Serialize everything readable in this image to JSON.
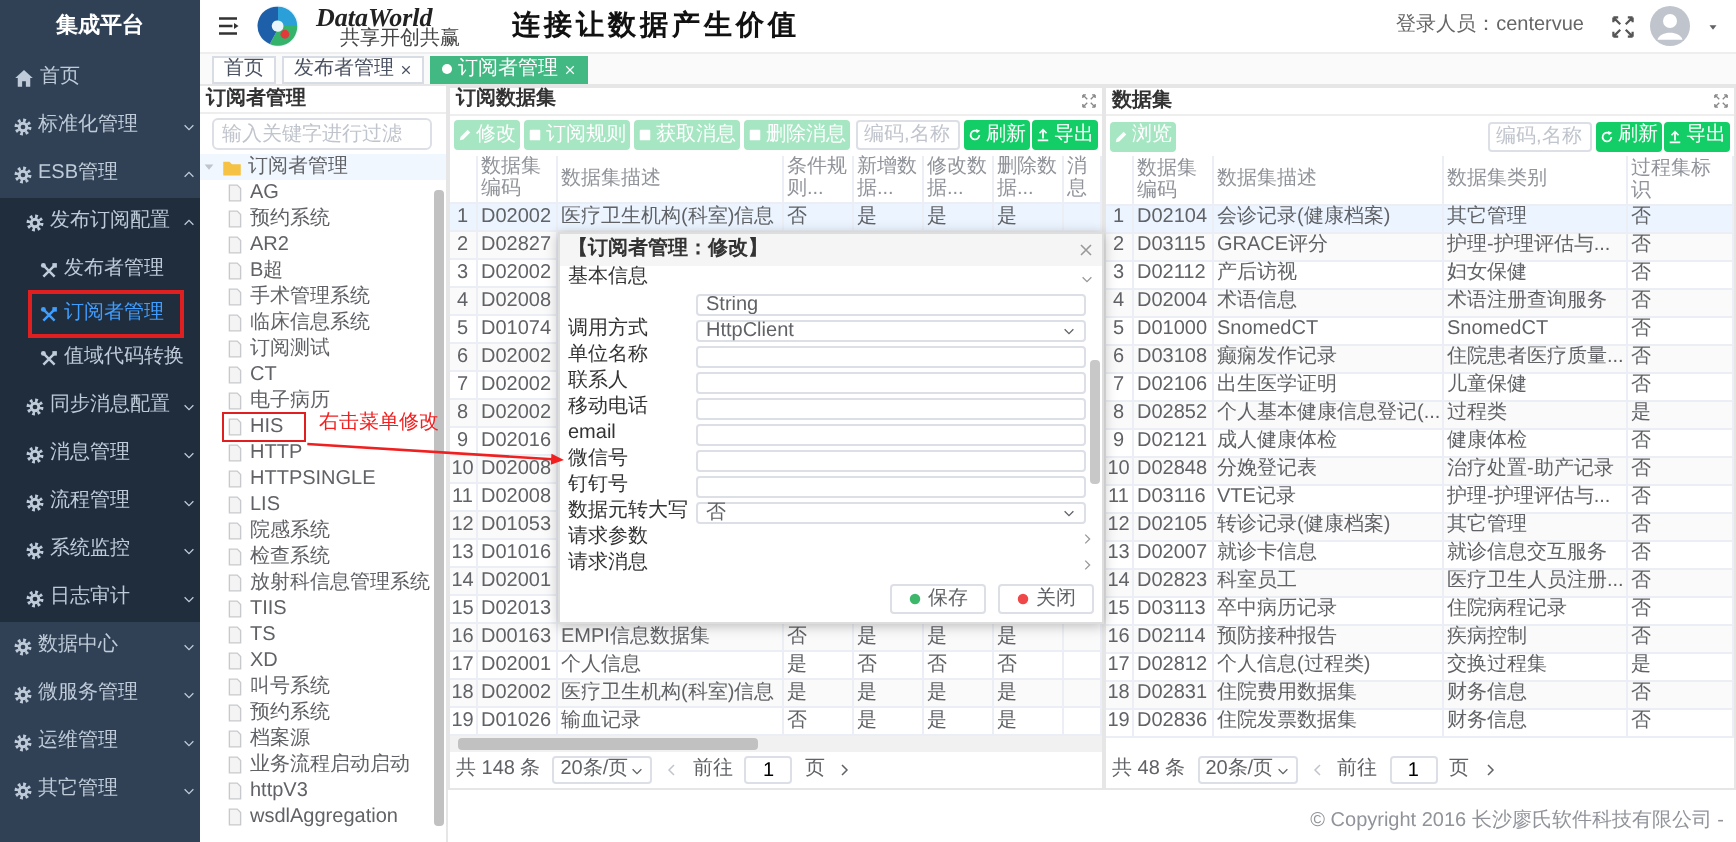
{
  "sidebar": {
    "title": "集成平台",
    "items": [
      {
        "kind": "home",
        "label": "首页"
      },
      {
        "kind": "group",
        "label": "标准化管理",
        "expanded": false
      },
      {
        "kind": "group",
        "label": "ESB管理",
        "expanded": true,
        "children": [
          {
            "kind": "group",
            "label": "发布订阅配置",
            "expanded": true,
            "children": [
              {
                "kind": "page",
                "label": "发布者管理",
                "selected": false,
                "boxed": false
              },
              {
                "kind": "page",
                "label": "订阅者管理",
                "selected": true,
                "boxed": true
              },
              {
                "kind": "page",
                "label": "值域代码转换",
                "selected": false,
                "boxed": false
              }
            ]
          },
          {
            "kind": "group",
            "label": "同步消息配置",
            "expanded": false
          },
          {
            "kind": "group",
            "label": "消息管理",
            "expanded": false
          },
          {
            "kind": "group",
            "label": "流程管理",
            "expanded": false
          },
          {
            "kind": "group",
            "label": "系统监控",
            "expanded": false
          },
          {
            "kind": "group",
            "label": "日志审计",
            "expanded": false
          }
        ]
      },
      {
        "kind": "group",
        "label": "数据中心",
        "expanded": false
      },
      {
        "kind": "group",
        "label": "微服务管理",
        "expanded": false
      },
      {
        "kind": "group",
        "label": "运维管理",
        "expanded": false
      },
      {
        "kind": "group",
        "label": "其它管理",
        "expanded": false
      }
    ]
  },
  "header": {
    "logo_name": "DataWorld",
    "logo_tagline": "共享开创共赢",
    "slogan": "连接让数据产生价值",
    "user_label": "登录人员：centervue"
  },
  "tabs": [
    {
      "label": "首页",
      "selected": false,
      "closable": false
    },
    {
      "label": "发布者管理",
      "selected": false,
      "closable": true
    },
    {
      "label": "订阅者管理",
      "selected": true,
      "closable": true
    }
  ],
  "tree": {
    "title": "订阅者管理",
    "placeholder": "输入关键字进行过滤",
    "root": {
      "label": "订阅者管理",
      "expanded": true,
      "children": [
        {
          "label": "AG",
          "boxed": false
        },
        {
          "label": "预约系统",
          "boxed": false
        },
        {
          "label": "AR2",
          "boxed": false
        },
        {
          "label": "B超",
          "boxed": false
        },
        {
          "label": "手术管理系统",
          "boxed": false
        },
        {
          "label": "临床信息系统",
          "boxed": false
        },
        {
          "label": "订阅测试",
          "boxed": false
        },
        {
          "label": "CT",
          "boxed": false
        },
        {
          "label": "电子病历",
          "boxed": false
        },
        {
          "label": "HIS",
          "boxed": true
        },
        {
          "label": "HTTP",
          "boxed": false
        },
        {
          "label": "HTTPSINGLE",
          "boxed": false
        },
        {
          "label": "LIS",
          "boxed": false
        },
        {
          "label": "院感系统",
          "boxed": false
        },
        {
          "label": "检查系统",
          "boxed": false
        },
        {
          "label": "放射科信息管理系统",
          "boxed": false
        },
        {
          "label": "TIIS",
          "boxed": false
        },
        {
          "label": "TS",
          "boxed": false
        },
        {
          "label": "XD",
          "boxed": false
        },
        {
          "label": "叫号系统",
          "boxed": false
        },
        {
          "label": "预约系统",
          "boxed": false
        },
        {
          "label": "档案源",
          "boxed": false
        },
        {
          "label": "业务流程启动启动",
          "boxed": false
        },
        {
          "label": "httpV3",
          "boxed": false
        },
        {
          "label": "wsdlAggregation",
          "boxed": false
        }
      ]
    }
  },
  "annotation": {
    "text": "右击菜单修改"
  },
  "subscribed_panel": {
    "title": "订阅数据集",
    "toolbar": [
      {
        "label": "修改",
        "kind": "edit",
        "disabled": true
      },
      {
        "label": "订阅规则",
        "kind": "doc",
        "disabled": true
      },
      {
        "label": "获取消息",
        "kind": "doc",
        "disabled": true
      },
      {
        "label": "删除消息",
        "kind": "doc",
        "disabled": true
      }
    ],
    "search_placeholder": "编码,名称",
    "actions": [
      {
        "label": "刷新",
        "kind": "refresh",
        "disabled": false
      },
      {
        "label": "导出",
        "kind": "export",
        "disabled": false
      }
    ],
    "columns": [
      "数据集编码",
      "数据集描述",
      "条件规则...",
      "新增数据...",
      "修改数据...",
      "删除数据...",
      "消息"
    ],
    "rows": [
      {
        "no": "1",
        "selected": true,
        "cells": [
          "D02002",
          "医疗卫生机构(科室)信息",
          "否",
          "是",
          "是",
          "是"
        ]
      },
      {
        "no": "2",
        "selected": false,
        "cells": [
          "D02827"
        ]
      },
      {
        "no": "3",
        "selected": false,
        "cells": [
          "D02002"
        ]
      },
      {
        "no": "4",
        "selected": false,
        "cells": [
          "D02008"
        ]
      },
      {
        "no": "5",
        "selected": false,
        "cells": [
          "D01074"
        ]
      },
      {
        "no": "6",
        "selected": false,
        "cells": [
          "D02002"
        ]
      },
      {
        "no": "7",
        "selected": false,
        "cells": [
          "D02002"
        ]
      },
      {
        "no": "8",
        "selected": false,
        "cells": [
          "D02002"
        ]
      },
      {
        "no": "9",
        "selected": false,
        "cells": [
          "D02016"
        ]
      },
      {
        "no": "10",
        "selected": false,
        "cells": [
          "D02008"
        ]
      },
      {
        "no": "11",
        "selected": false,
        "cells": [
          "D02008"
        ]
      },
      {
        "no": "12",
        "selected": false,
        "cells": [
          "D01053"
        ]
      },
      {
        "no": "13",
        "selected": false,
        "cells": [
          "D01016"
        ]
      },
      {
        "no": "14",
        "selected": false,
        "cells": [
          "D02001"
        ]
      },
      {
        "no": "15",
        "selected": false,
        "cells": [
          "D02013"
        ]
      },
      {
        "no": "16",
        "selected": false,
        "cells": [
          "D00163",
          "EMPI信息数据集",
          "否",
          "是",
          "是",
          "是"
        ]
      },
      {
        "no": "17",
        "selected": false,
        "cells": [
          "D02001",
          "个人信息",
          "是",
          "否",
          "否",
          "否"
        ]
      },
      {
        "no": "18",
        "selected": false,
        "cells": [
          "D02002",
          "医疗卫生机构(科室)信息",
          "是",
          "是",
          "是",
          "是"
        ]
      },
      {
        "no": "19",
        "selected": false,
        "cells": [
          "D01026",
          "输血记录",
          "否",
          "是",
          "是",
          "是"
        ]
      }
    ],
    "total": "共 148 条",
    "page_size": "20条/页",
    "goto_label": "前往",
    "page": "1",
    "page_unit": "页"
  },
  "dataset_panel": {
    "title": "数据集",
    "toolbar": [
      {
        "label": "浏览",
        "kind": "edit",
        "disabled": true
      }
    ],
    "search_placeholder": "编码,名称",
    "actions": [
      {
        "label": "刷新",
        "kind": "refresh",
        "disabled": false
      },
      {
        "label": "导出",
        "kind": "export",
        "disabled": false
      }
    ],
    "columns": [
      "数据集编码",
      "数据集描述",
      "数据集类别",
      "过程集标识"
    ],
    "rows": [
      {
        "no": "1",
        "selected": true,
        "cells": [
          "D02104",
          "会诊记录(健康档案)",
          "其它管理",
          "否"
        ]
      },
      {
        "no": "2",
        "selected": false,
        "cells": [
          "D03115",
          "GRACE评分",
          "护理-护理评估与...",
          "否"
        ]
      },
      {
        "no": "3",
        "selected": false,
        "cells": [
          "D02112",
          "产后访视",
          "妇女保健",
          "否"
        ]
      },
      {
        "no": "4",
        "selected": false,
        "cells": [
          "D02004",
          "术语信息",
          "术语注册查询服务",
          "否"
        ]
      },
      {
        "no": "5",
        "selected": false,
        "cells": [
          "D01000",
          "SnomedCT",
          "SnomedCT",
          "否"
        ]
      },
      {
        "no": "6",
        "selected": false,
        "cells": [
          "D03108",
          "癫痫发作记录",
          "住院患者医疗质量...",
          "否"
        ]
      },
      {
        "no": "7",
        "selected": false,
        "cells": [
          "D02106",
          "出生医学证明",
          "儿童保健",
          "否"
        ]
      },
      {
        "no": "8",
        "selected": false,
        "cells": [
          "D02852",
          "个人基本健康信息登记(...",
          "过程类",
          "是"
        ]
      },
      {
        "no": "9",
        "selected": false,
        "cells": [
          "D02121",
          "成人健康体检",
          "健康体检",
          "否"
        ]
      },
      {
        "no": "10",
        "selected": false,
        "cells": [
          "D02848",
          "分娩登记表",
          "治疗处置-助产记录",
          "否"
        ]
      },
      {
        "no": "11",
        "selected": false,
        "cells": [
          "D03116",
          "VTE记录",
          "护理-护理评估与...",
          "否"
        ]
      },
      {
        "no": "12",
        "selected": false,
        "cells": [
          "D02105",
          "转诊记录(健康档案)",
          "其它管理",
          "否"
        ]
      },
      {
        "no": "13",
        "selected": false,
        "cells": [
          "D02007",
          "就诊卡信息",
          "就诊信息交互服务",
          "否"
        ]
      },
      {
        "no": "14",
        "selected": false,
        "cells": [
          "D02823",
          "科室员工",
          "医疗卫生人员注册...",
          "否"
        ]
      },
      {
        "no": "15",
        "selected": false,
        "cells": [
          "D03113",
          "卒中病历记录",
          "住院病程记录",
          "否"
        ]
      },
      {
        "no": "16",
        "selected": false,
        "cells": [
          "D02114",
          "预防接种报告",
          "疾病控制",
          "否"
        ]
      },
      {
        "no": "17",
        "selected": false,
        "cells": [
          "D02812",
          "个人信息(过程类)",
          "交换过程集",
          "是"
        ]
      },
      {
        "no": "18",
        "selected": false,
        "cells": [
          "D02831",
          "住院费用数据集",
          "财务信息",
          "否"
        ]
      },
      {
        "no": "19",
        "selected": false,
        "cells": [
          "D02836",
          "住院发票数据集",
          "财务信息",
          "否"
        ]
      }
    ],
    "total": "共 48 条",
    "page_size": "20条/页",
    "goto_label": "前往",
    "page": "1",
    "page_unit": "页"
  },
  "modal": {
    "title": "【订阅者管理：修改】",
    "sections": [
      {
        "label": "基本信息",
        "expanded": true,
        "fields": [
          {
            "kind": "text",
            "value": "String"
          },
          {
            "kind": "select",
            "label": "调用方式",
            "value": "HttpClient"
          },
          {
            "kind": "text",
            "label": "单位名称"
          },
          {
            "kind": "text",
            "label": "联系人"
          },
          {
            "kind": "text",
            "label": "移动电话"
          },
          {
            "kind": "text",
            "label": "email"
          },
          {
            "kind": "text",
            "label": "微信号"
          },
          {
            "kind": "text",
            "label": "钉钉号"
          },
          {
            "kind": "select",
            "label": "数据元转大写",
            "value": "否"
          }
        ]
      },
      {
        "label": "请求参数",
        "expanded": false
      },
      {
        "label": "请求消息",
        "expanded": false
      }
    ],
    "buttons": [
      {
        "label": "保存",
        "kind": "save"
      },
      {
        "label": "关闭",
        "kind": "close"
      }
    ]
  },
  "footer": {
    "copyright": "© Copyright 2016 长沙廖氏软件科技有限公司 -"
  }
}
